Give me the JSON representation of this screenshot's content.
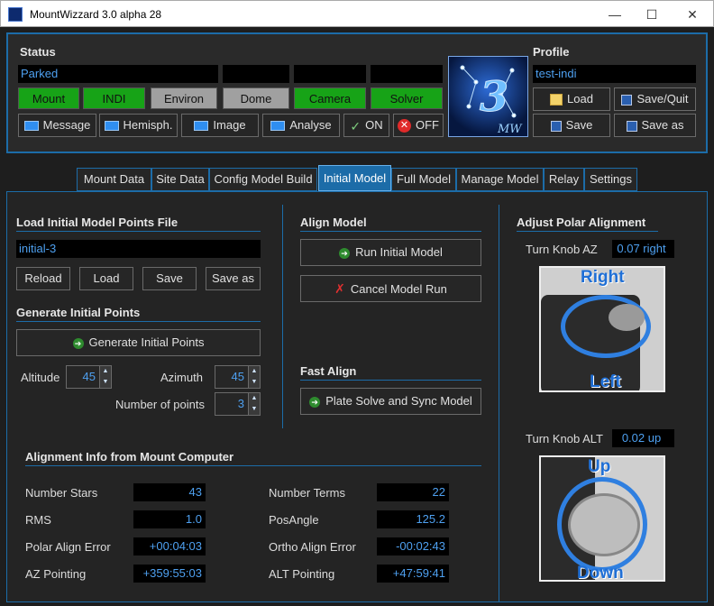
{
  "window": {
    "title": "MountWizzard 3.0 alpha 28",
    "minimize": "—",
    "maximize": "☐",
    "close": "✕"
  },
  "status": {
    "heading": "Status",
    "mount_state": "Parked",
    "tags": [
      {
        "label": "Mount",
        "state": "green"
      },
      {
        "label": "INDI",
        "state": "green"
      },
      {
        "label": "Environ",
        "state": "gray"
      },
      {
        "label": "Dome",
        "state": "gray"
      },
      {
        "label": "Camera",
        "state": "green"
      },
      {
        "label": "Solver",
        "state": "green"
      }
    ],
    "buttons": {
      "message": "Message",
      "hemisphere": "Hemisph.",
      "image": "Image",
      "analyse": "Analyse",
      "on": "ON",
      "off": "OFF"
    }
  },
  "logo": {
    "number": "3",
    "letters": "MW"
  },
  "profile": {
    "heading": "Profile",
    "name": "test-indi",
    "load": "Load",
    "save_quit": "Save/Quit",
    "save": "Save",
    "save_as": "Save as"
  },
  "tabs": [
    "Mount Data",
    "Site Data",
    "Config Model Build",
    "Initial Model",
    "Full Model",
    "Manage Model",
    "Relay",
    "Settings"
  ],
  "active_tab": "Initial Model",
  "load_section": {
    "heading": "Load Initial Model Points File",
    "file": "initial-3",
    "reload": "Reload",
    "load": "Load",
    "save": "Save",
    "save_as": "Save as"
  },
  "generate_section": {
    "heading": "Generate Initial Points",
    "button": "Generate Initial Points",
    "altitude_label": "Altitude",
    "altitude": "45",
    "azimuth_label": "Azimuth",
    "azimuth": "45",
    "points_label": "Number of points",
    "points": "3"
  },
  "align_section": {
    "heading": "Align Model",
    "run": "Run Initial Model",
    "cancel": "Cancel Model Run"
  },
  "fast_align": {
    "heading": "Fast Align",
    "button": "Plate Solve and Sync Model"
  },
  "polar": {
    "heading": "Adjust Polar Alignment",
    "az_label": "Turn Knob AZ",
    "az_value": "0.07 right",
    "az_img_top": "Right",
    "az_img_bottom": "Left",
    "alt_label": "Turn Knob ALT",
    "alt_value": "0.02 up",
    "alt_img_top": "Up",
    "alt_img_bottom": "Down"
  },
  "alignment_info": {
    "heading": "Alignment Info from Mount Computer",
    "rows": [
      {
        "l1": "Number Stars",
        "v1": "43",
        "l2": "Number Terms",
        "v2": "22"
      },
      {
        "l1": "RMS",
        "v1": "1.0",
        "l2": "PosAngle",
        "v2": "125.2"
      },
      {
        "l1": "Polar Align Error",
        "v1": "+00:04:03",
        "l2": "Ortho Align Error",
        "v2": "-00:02:43"
      },
      {
        "l1": "AZ Pointing",
        "v1": "+359:55:03",
        "l2": "ALT Pointing",
        "v2": "+47:59:41"
      }
    ]
  },
  "colors": {
    "accent": "#1c6ca8",
    "value_text": "#4ea0f0",
    "status_green": "#17a317",
    "status_gray": "#a0a0a0"
  },
  "icons": [
    "app-icon",
    "monitor-icon",
    "check-icon",
    "error-icon",
    "folder-icon",
    "floppy-icon",
    "arrow-right-icon",
    "cancel-x-icon"
  ]
}
